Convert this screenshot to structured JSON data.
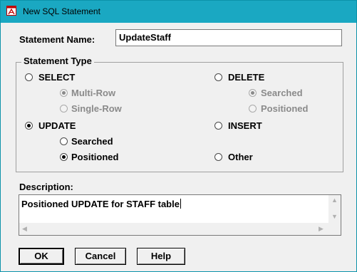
{
  "window": {
    "title": "New SQL Statement"
  },
  "statement_name": {
    "label": "Statement Name:",
    "value": "UpdateStaff"
  },
  "statement_type": {
    "title": "Statement Type",
    "select": {
      "label": "SELECT",
      "selected": false
    },
    "select_multi_row": {
      "label": "Multi-Row",
      "selected": true,
      "enabled": false
    },
    "select_single_row": {
      "label": "Single-Row",
      "selected": false,
      "enabled": false
    },
    "update": {
      "label": "UPDATE",
      "selected": true
    },
    "update_searched": {
      "label": "Searched",
      "selected": false
    },
    "update_positioned": {
      "label": "Positioned",
      "selected": true
    },
    "delete": {
      "label": "DELETE",
      "selected": false
    },
    "delete_searched": {
      "label": "Searched",
      "selected": true,
      "enabled": false
    },
    "delete_positioned": {
      "label": "Positioned",
      "selected": false,
      "enabled": false
    },
    "insert": {
      "label": "INSERT",
      "selected": false
    },
    "other": {
      "label": "Other",
      "selected": false
    }
  },
  "description": {
    "label": "Description:",
    "value": "Positioned UPDATE for STAFF table"
  },
  "buttons": {
    "ok": "OK",
    "cancel": "Cancel",
    "help": "Help"
  }
}
